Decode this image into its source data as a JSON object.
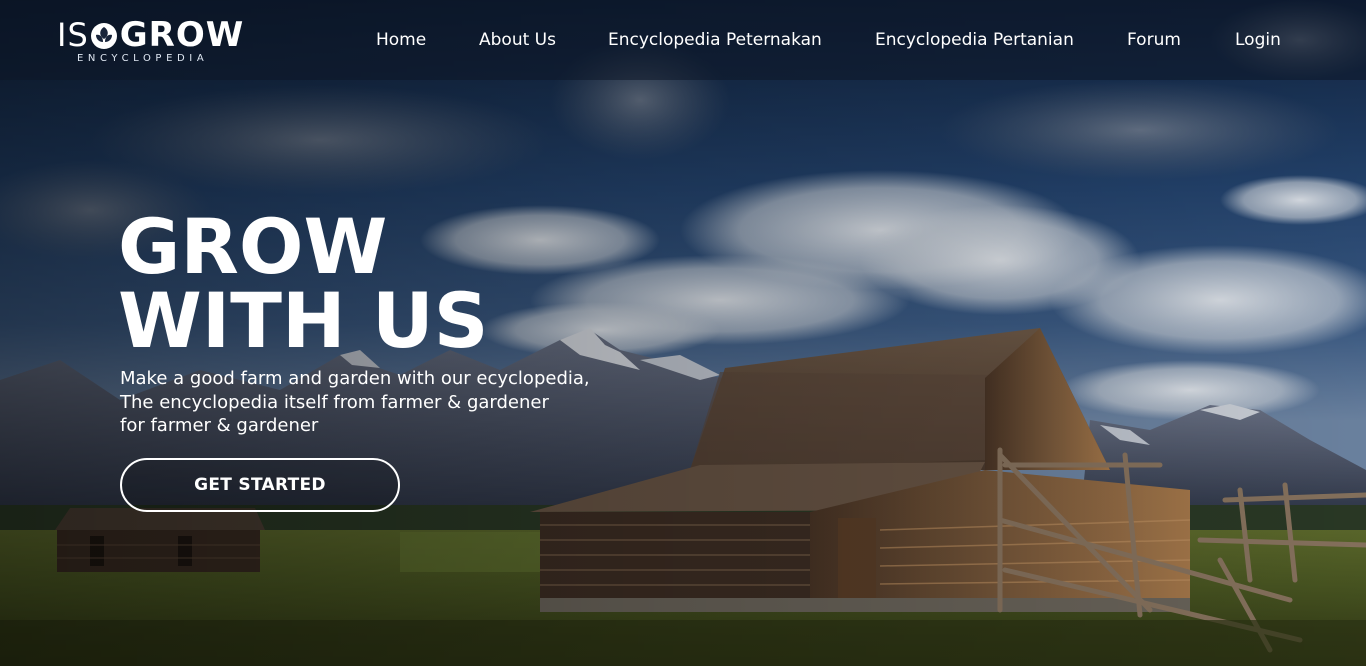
{
  "brand": {
    "logo_prefix": "IS",
    "logo_word": "GROW",
    "logo_sub": "ENCYCLOPEDIA",
    "icon": "leaf-logo-icon"
  },
  "nav": {
    "items": [
      {
        "label": "Home"
      },
      {
        "label": "About Us"
      },
      {
        "label": "Encyclopedia Peternakan"
      },
      {
        "label": "Encyclopedia Pertanian"
      },
      {
        "label": "Forum"
      },
      {
        "label": "Login"
      }
    ]
  },
  "hero": {
    "title_line1": "GROW",
    "title_line2": "WITH US",
    "desc_line1": "Make a good farm and garden with our ecyclopedia,",
    "desc_line2": "The encyclopedia itself from farmer & gardener",
    "desc_line3": "for farmer & gardener",
    "cta_label": "GET STARTED"
  },
  "colors": {
    "nav_bg": "#0c1626",
    "text": "#ffffff",
    "sky": "#2c4a78",
    "grass": "#4a5a24"
  }
}
